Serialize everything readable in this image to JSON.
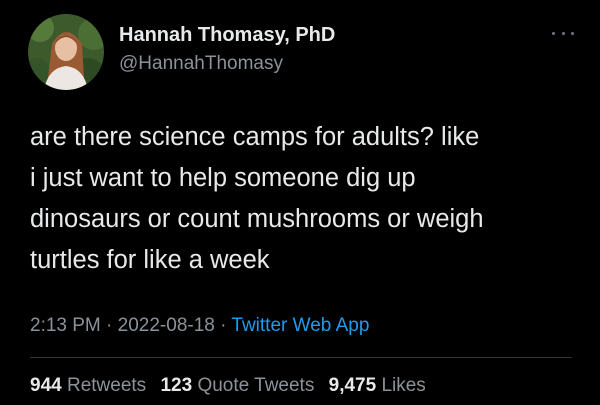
{
  "author": {
    "display_name": "Hannah Thomasy, PhD",
    "handle": "@HannahThomasy",
    "avatar_icon": "profile-photo"
  },
  "tweet": {
    "lines": [
      "are there science camps for adults? like",
      "i just want to help someone dig up",
      "dinosaurs or count mushrooms or weigh",
      "turtles for like a week"
    ],
    "time": "2:13 PM",
    "date": "2022-08-18",
    "separator": "·",
    "source": "Twitter Web App"
  },
  "stats": {
    "retweets_count": "944",
    "retweets_label": "Retweets",
    "quote_tweets_count": "123",
    "quote_tweets_label": "Quote Tweets",
    "likes_count": "9,475",
    "likes_label": "Likes"
  },
  "colors": {
    "background": "#000000",
    "text": "#e7e9ea",
    "secondary": "#8b9299",
    "link": "#1d9bf0"
  }
}
